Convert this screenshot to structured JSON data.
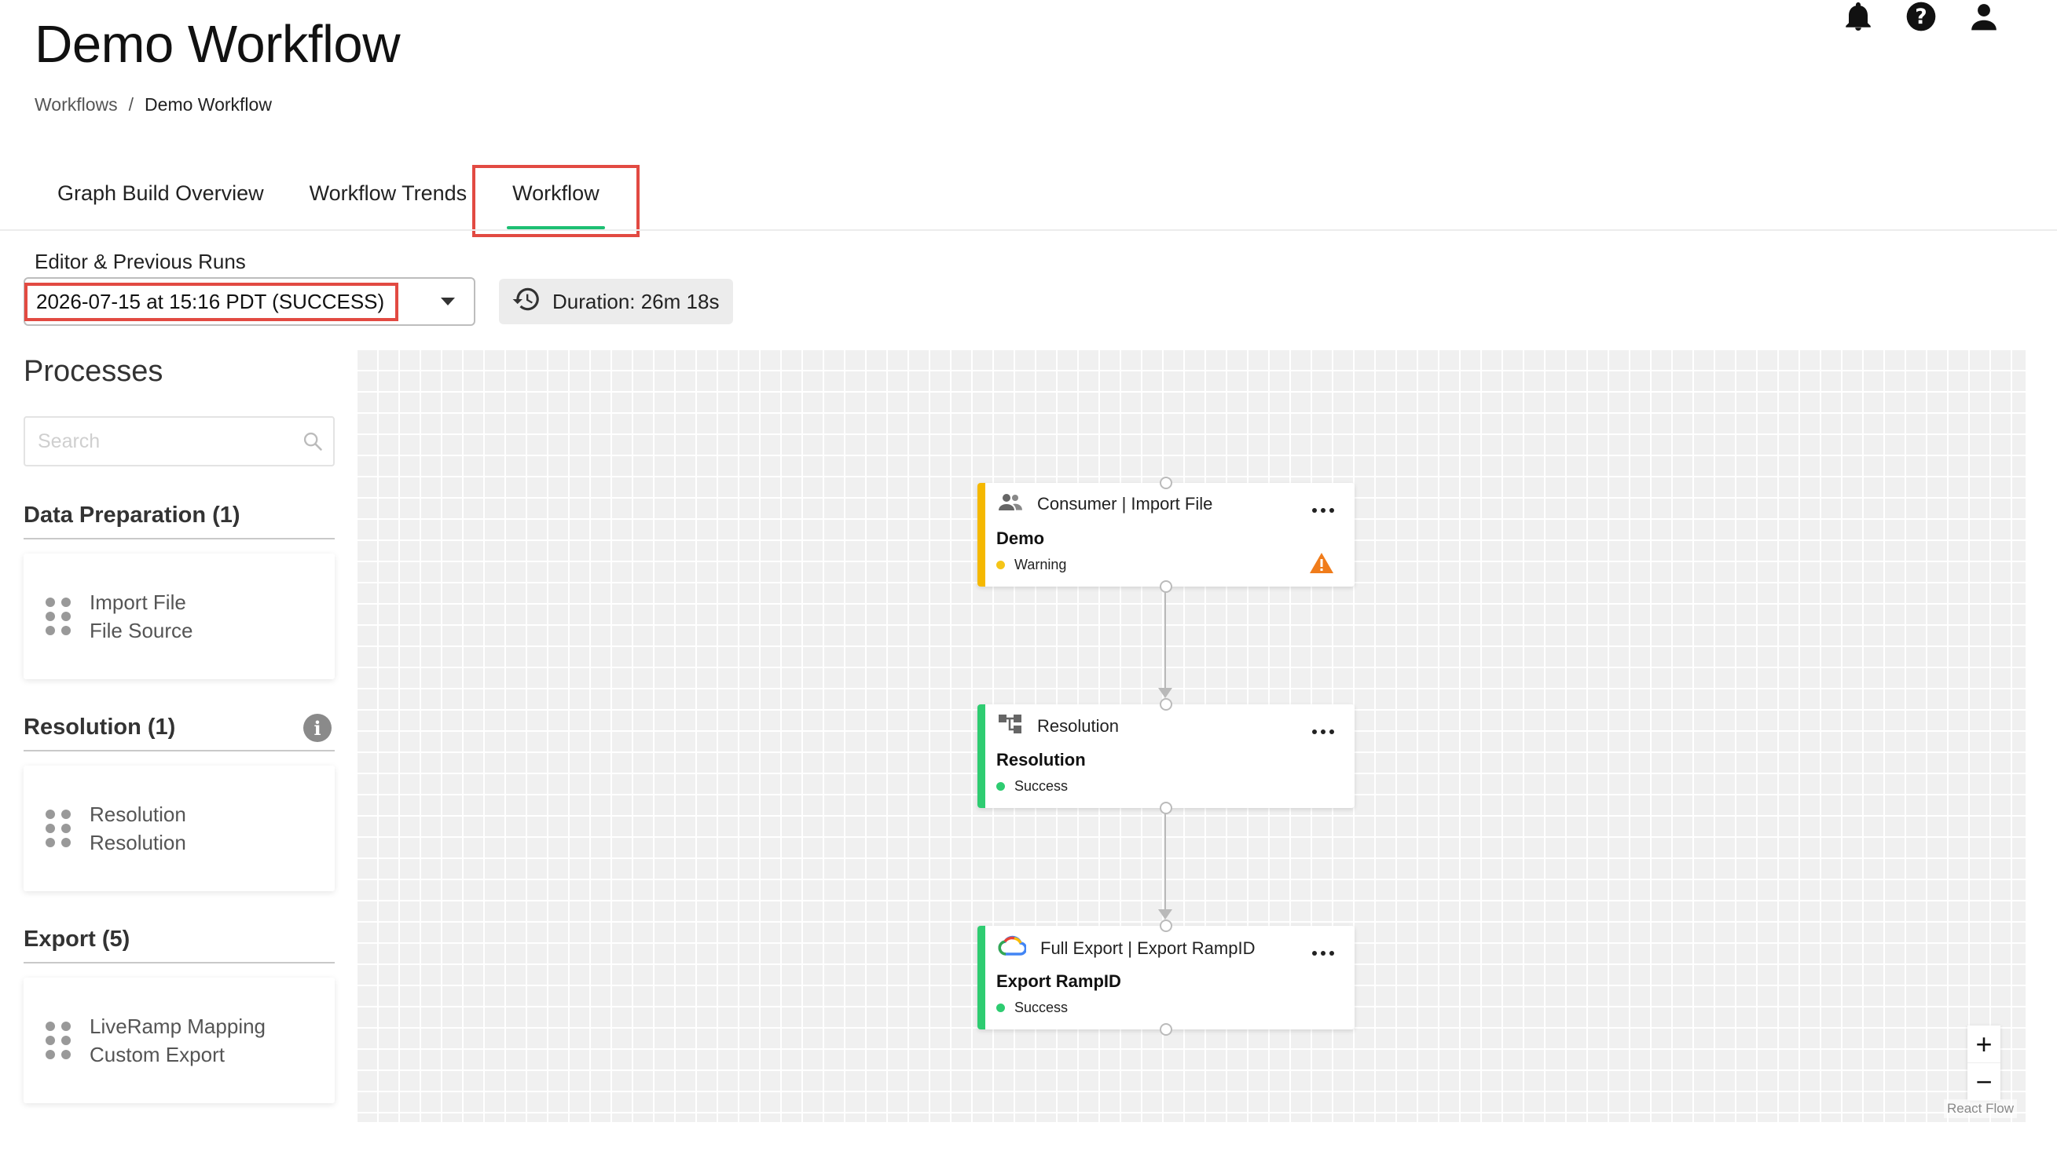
{
  "header": {
    "title": "Demo Workflow",
    "breadcrumb": {
      "root": "Workflows",
      "separator": "/",
      "current": "Demo Workflow"
    },
    "icons": [
      "bell-icon",
      "help-icon",
      "user-icon"
    ]
  },
  "tabs": [
    {
      "label": "Graph Build Overview",
      "active": false
    },
    {
      "label": "Workflow Trends",
      "active": false
    },
    {
      "label": "Workflow",
      "active": true
    }
  ],
  "runs": {
    "label": "Editor & Previous Runs",
    "selected": "2026-07-15 at 15:16 PDT (SUCCESS)",
    "duration": "Duration: 26m 18s"
  },
  "processes": {
    "title": "Processes",
    "search_placeholder": "Search",
    "sections": [
      {
        "title": "Data Preparation (1)",
        "items": [
          {
            "line1": "Import File",
            "line2": "File Source"
          }
        ]
      },
      {
        "title": "Resolution (1)",
        "items": [
          {
            "line1": "Resolution",
            "line2": "Resolution"
          }
        ]
      },
      {
        "title": "Export (5)",
        "items": [
          {
            "line1": "LiveRamp Mapping",
            "line2": "Custom Export"
          }
        ]
      }
    ]
  },
  "nodes": [
    {
      "header": "Consumer | Import File",
      "name": "Demo",
      "status": "Warning",
      "status_color": "#f5c518",
      "accent": "#f5b800",
      "icon": "users-icon"
    },
    {
      "header": "Resolution",
      "name": "Resolution",
      "status": "Success",
      "status_color": "#2ecc71",
      "accent": "#2ecc71",
      "icon": "resolution-icon"
    },
    {
      "header": "Full Export | Export RampID",
      "name": "Export RampID",
      "status": "Success",
      "status_color": "#2ecc71",
      "accent": "#2ecc71",
      "icon": "google-cloud-icon"
    }
  ],
  "canvas": {
    "zoom_in": "+",
    "zoom_out": "−",
    "attribution": "React Flow"
  },
  "colors": {
    "tab_active_underline": "#1dbf73",
    "highlight": "#e24a42",
    "warning_icon": "#f07c1b"
  }
}
